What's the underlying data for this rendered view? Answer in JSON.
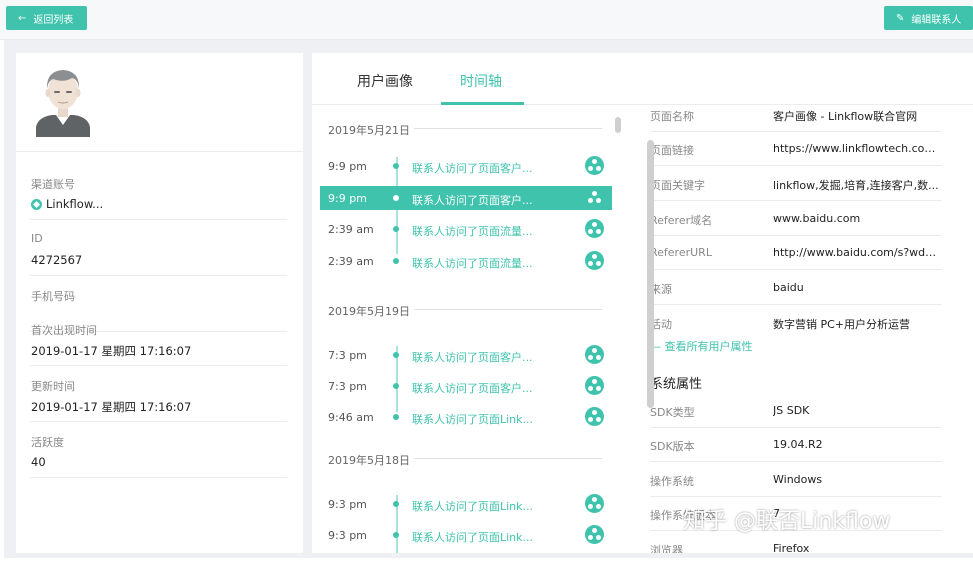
{
  "toolbar": {
    "back_label": "返回列表",
    "edit_label": "编辑联系人"
  },
  "profile": {
    "fields": [
      {
        "label": "渠道账号",
        "value": "Linkflow..."
      },
      {
        "label": "ID",
        "value": "4272567"
      },
      {
        "label": "手机号码",
        "value": ""
      },
      {
        "label": "首次出现时间",
        "value": "2019-01-17 星期四 17:16:07"
      },
      {
        "label": "更新时间",
        "value": "2019-01-17 星期四 17:16:07"
      },
      {
        "label": "活跃度",
        "value": "40"
      }
    ]
  },
  "tabs": [
    {
      "label": "用户画像",
      "active": false
    },
    {
      "label": "时间轴",
      "active": true
    }
  ],
  "timeline": {
    "groups": [
      {
        "date": "2019年5月21日",
        "events": [
          {
            "time": "9:9 pm",
            "text": "联系人访问了页面客户...",
            "selected": false
          },
          {
            "time": "9:9 pm",
            "text": "联系人访问了页面客户...",
            "selected": true
          },
          {
            "time": "2:39 am",
            "text": "联系人访问了页面流量...",
            "selected": false
          },
          {
            "time": "2:39 am",
            "text": "联系人访问了页面流量...",
            "selected": false
          }
        ]
      },
      {
        "date": "2019年5月19日",
        "events": [
          {
            "time": "7:3 pm",
            "text": "联系人访问了页面客户...",
            "selected": false
          },
          {
            "time": "7:3 pm",
            "text": "联系人访问了页面客户...",
            "selected": false
          },
          {
            "time": "9:46 am",
            "text": "联系人访问了页面Link...",
            "selected": false
          }
        ]
      },
      {
        "date": "2019年5月18日",
        "events": [
          {
            "time": "9:3 pm",
            "text": "联系人访问了页面Link...",
            "selected": false
          },
          {
            "time": "9:3 pm",
            "text": "联系人访问了页面Link...",
            "selected": false
          }
        ]
      }
    ]
  },
  "event_props": [
    {
      "key": "页面名称",
      "value": "客户画像 - Linkflow联合官网"
    },
    {
      "key": "页面链接",
      "value": "https://www.linkflowtech.com..."
    },
    {
      "key": "页面关键字",
      "value": "linkflow,发掘,培育,连接客户,数..."
    },
    {
      "key": "Referer域名",
      "value": "www.baidu.com"
    },
    {
      "key": "RefererURL",
      "value": "http://www.baidu.com/s?wd=..."
    },
    {
      "key": "来源",
      "value": "baidu"
    },
    {
      "key": "活动",
      "value": "数字营销 PC+用户分析运营"
    }
  ],
  "more_link": "— 查看所有用户属性",
  "system_section": {
    "title": "系统属性",
    "props": [
      {
        "key": "SDK类型",
        "value": "JS SDK"
      },
      {
        "key": "SDK版本",
        "value": "19.04.R2"
      },
      {
        "key": "操作系统",
        "value": "Windows"
      },
      {
        "key": "操作系统版本",
        "value": "7"
      },
      {
        "key": "浏览器",
        "value": "Firefox"
      }
    ]
  },
  "watermark": "知乎 @联否Linkflow",
  "colors": {
    "accent": "#3fc3ad",
    "panel_bg": "#eef0f3"
  }
}
